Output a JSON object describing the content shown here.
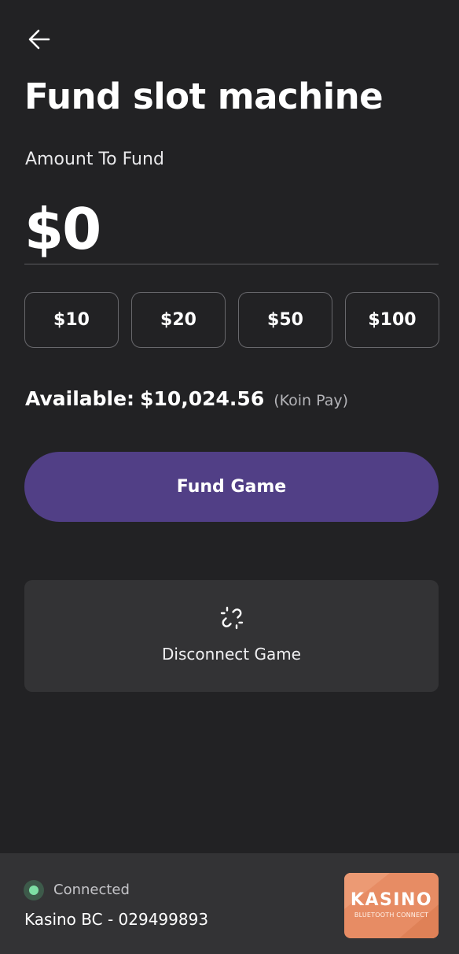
{
  "header": {
    "back_icon": "arrow-left-icon",
    "title": "Fund slot machine"
  },
  "amount": {
    "label": "Amount To Fund",
    "value": "$0"
  },
  "presets": [
    {
      "label": "$10"
    },
    {
      "label": "$20"
    },
    {
      "label": "$50"
    },
    {
      "label": "$100"
    }
  ],
  "balance": {
    "label": "Available:",
    "amount": "$10,024.56",
    "source": "(Koin Pay)"
  },
  "fund_button": {
    "label": "Fund Game",
    "color": "#513f86"
  },
  "disconnect": {
    "icon": "broken-link-icon",
    "label": "Disconnect Game"
  },
  "footer": {
    "status": "Connected",
    "status_color": "#7ddfa4",
    "device": "Kasino BC - 029499893",
    "logo_text": "KASINO",
    "logo_subtext": "BLUETOOTH CONNECT",
    "logo_color": "#e78c64"
  }
}
